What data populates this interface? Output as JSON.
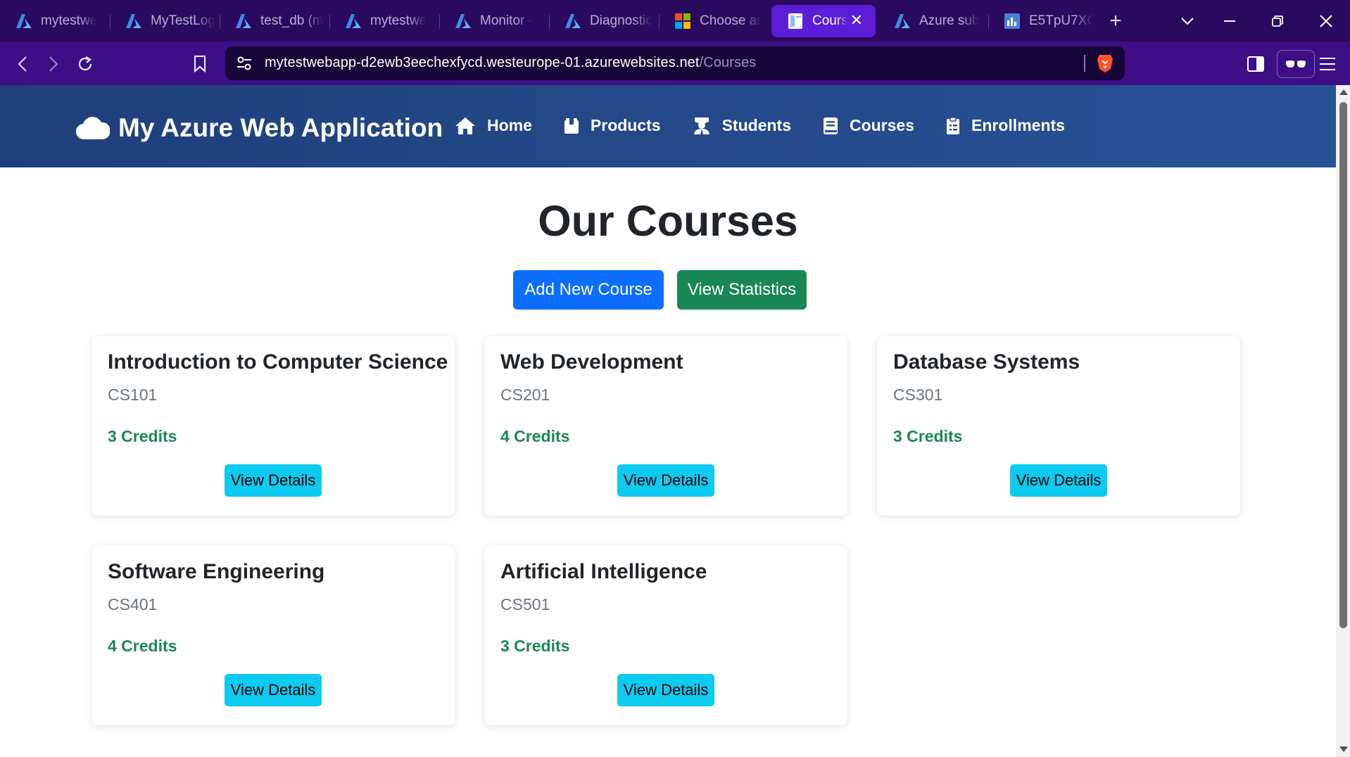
{
  "browser": {
    "tabs": [
      {
        "label": "mytestwe",
        "icon": "azure-icon"
      },
      {
        "label": "MyTestLog",
        "icon": "azure-icon"
      },
      {
        "label": "test_db (m",
        "icon": "azure-icon"
      },
      {
        "label": "mytestwe",
        "icon": "azure-icon"
      },
      {
        "label": "Monitor -",
        "icon": "azure-icon"
      },
      {
        "label": "Diagnostic",
        "icon": "azure-icon"
      },
      {
        "label": "Choose ar",
        "icon": "microsoft-icon"
      },
      {
        "label": "Cours",
        "icon": "page-icon",
        "active": true
      },
      {
        "label": "Azure sub",
        "icon": "azure-icon"
      },
      {
        "label": "E5TpU7XC",
        "icon": "chart-page-icon"
      }
    ],
    "close_tab_glyph": "✕",
    "new_tab_glyph": "+",
    "address": {
      "host": "mytestwebapp-d2ewb3eechexfycd.westeurope-01.azurewebsites.net",
      "path": "/Courses"
    }
  },
  "site": {
    "brand": "My Azure Web Application",
    "nav": [
      {
        "label": "Home",
        "icon": "home-icon"
      },
      {
        "label": "Products",
        "icon": "box-icon"
      },
      {
        "label": "Students",
        "icon": "graduate-icon"
      },
      {
        "label": "Courses",
        "icon": "book-icon"
      },
      {
        "label": "Enrollments",
        "icon": "clipboard-icon"
      }
    ]
  },
  "main": {
    "title": "Our Courses",
    "add_button": "Add New Course",
    "stats_button": "View Statistics",
    "courses": [
      {
        "title": "Introduction to Computer Science",
        "code": "CS101",
        "credits": "3 Credits",
        "button": "View Details"
      },
      {
        "title": "Web Development",
        "code": "CS201",
        "credits": "4 Credits",
        "button": "View Details"
      },
      {
        "title": "Database Systems",
        "code": "CS301",
        "credits": "3 Credits",
        "button": "View Details"
      },
      {
        "title": "Software Engineering",
        "code": "CS401",
        "credits": "4 Credits",
        "button": "View Details"
      },
      {
        "title": "Artificial Intelligence",
        "code": "CS501",
        "credits": "3 Credits",
        "button": "View Details"
      }
    ]
  },
  "colors": {
    "tabbar": "#2a0a5e",
    "addressbar": "#3c0f86",
    "active_tab": "#5b1dd6",
    "header_start": "#1f3f7a",
    "header_end": "#2a5298",
    "primary": "#0d6efd",
    "success": "#198754",
    "info": "#0dcaf0"
  }
}
